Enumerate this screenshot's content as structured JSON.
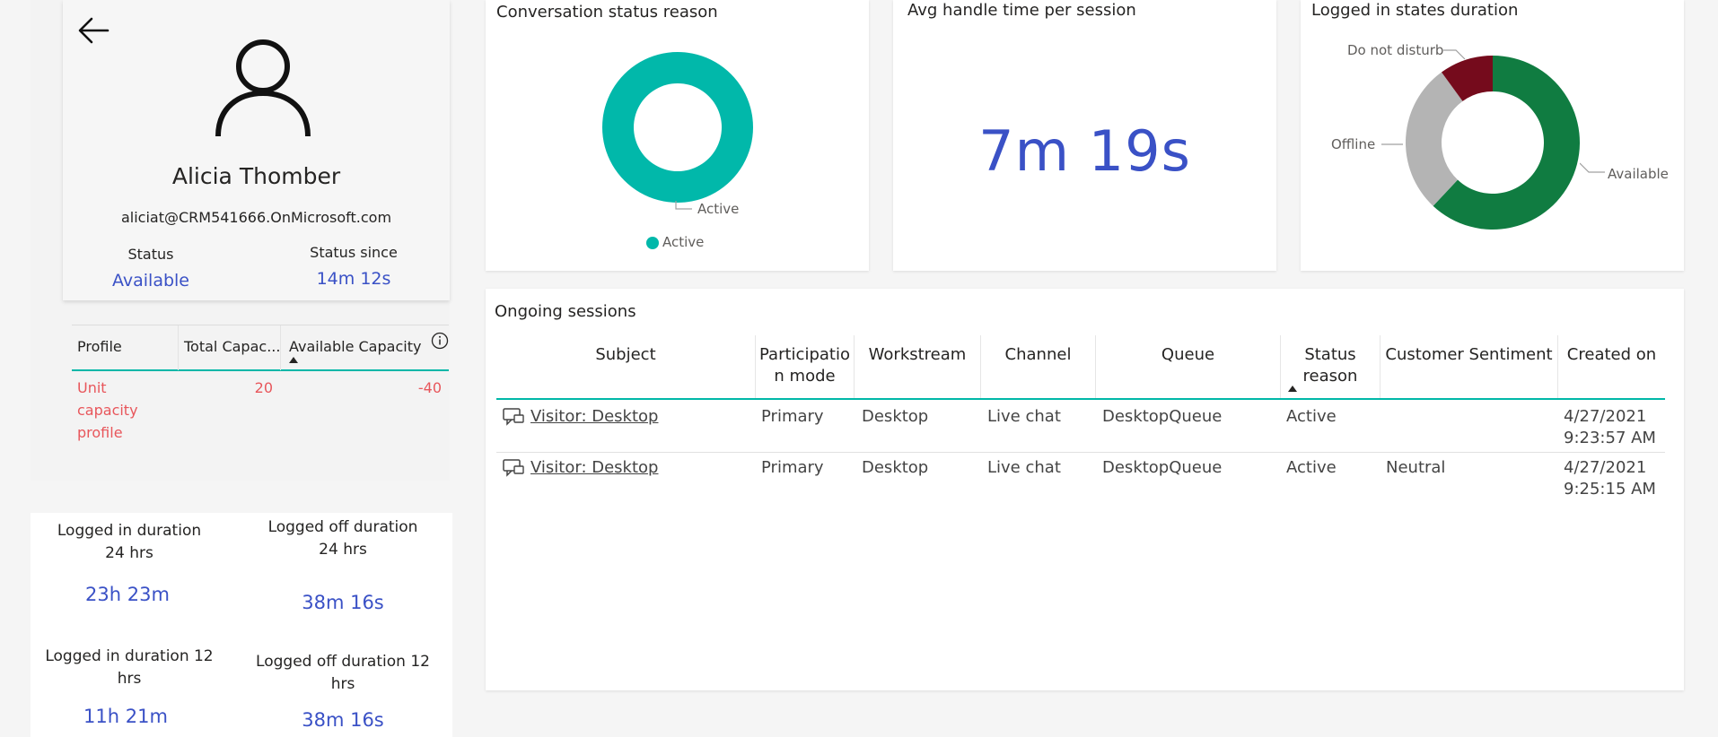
{
  "agent": {
    "name": "Alicia Thomber",
    "email": "aliciat@CRM541666.OnMicrosoft.com",
    "status_label": "Status",
    "status_value": "Available",
    "since_label": "Status since",
    "since_value": "14m 12s"
  },
  "capacity": {
    "headers": [
      "Profile",
      "Total Capac...",
      "Available Capacity"
    ],
    "rows": [
      {
        "profile_lines": [
          "Unit",
          "capacity",
          "profile"
        ],
        "total": "20",
        "available": "-40"
      }
    ]
  },
  "durations": [
    {
      "label_lines": [
        "Logged in duration",
        "24 hrs"
      ],
      "value": "23h 23m"
    },
    {
      "label_lines": [
        "Logged off duration",
        "24 hrs"
      ],
      "value": "38m 16s"
    },
    {
      "label_lines": [
        "Logged in duration 12",
        "hrs"
      ],
      "value": "11h 21m"
    },
    {
      "label_lines": [
        "Logged off duration 12",
        "hrs"
      ],
      "value": "38m 16s"
    }
  ],
  "cards": {
    "conversation_status": {
      "title": "Conversation status reason",
      "slice_label": "Active",
      "legend_label": "Active",
      "color": "#01b8aa"
    },
    "aht": {
      "title": "Avg handle time per session",
      "value": "7m 19s"
    },
    "logged_states": {
      "title": "Logged in states duration",
      "labels": {
        "dnd": "Do not disturb",
        "offline": "Offline",
        "available": "Available"
      }
    }
  },
  "chart_data": [
    {
      "type": "pie",
      "title": "Conversation status reason",
      "categories": [
        "Active"
      ],
      "values": [
        100
      ],
      "colors": [
        "#01b8aa"
      ],
      "legend": "bottom"
    },
    {
      "type": "pie",
      "title": "Logged in states duration",
      "categories": [
        "Available",
        "Offline",
        "Do not disturb"
      ],
      "values": [
        62,
        28,
        10
      ],
      "colors": [
        "#107c41",
        "#b4b4b4",
        "#750b1c"
      ]
    }
  ],
  "sessions": {
    "title": "Ongoing sessions",
    "headers": [
      {
        "lines": [
          "Subject"
        ]
      },
      {
        "lines": [
          "Participatio",
          "n mode"
        ]
      },
      {
        "lines": [
          "Workstream"
        ]
      },
      {
        "lines": [
          "Channel"
        ]
      },
      {
        "lines": [
          "Queue"
        ]
      },
      {
        "lines": [
          "Status",
          "reason"
        ]
      },
      {
        "lines": [
          "Customer Sentiment"
        ]
      },
      {
        "lines": [
          "Created on"
        ]
      }
    ],
    "rows": [
      {
        "subject": "Visitor: Desktop",
        "mode": "Primary",
        "workstream": "Desktop",
        "channel": "Live chat",
        "queue": "DesktopQueue",
        "status": "Active",
        "sentiment": "",
        "created_date": "4/27/2021",
        "created_time": "9:23:57 AM"
      },
      {
        "subject": "Visitor: Desktop",
        "mode": "Primary",
        "workstream": "Desktop",
        "channel": "Live chat",
        "queue": "DesktopQueue",
        "status": "Active",
        "sentiment": "Neutral",
        "created_date": "4/27/2021",
        "created_time": "9:25:15 AM"
      }
    ]
  }
}
